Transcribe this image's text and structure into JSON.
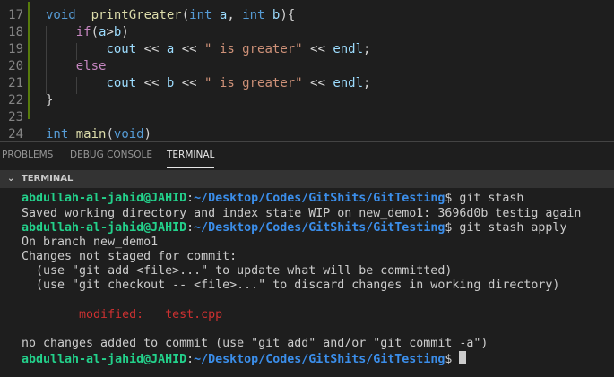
{
  "editor": {
    "line_numbers": [
      "17",
      "18",
      "19",
      "20",
      "21",
      "22",
      "23",
      "24"
    ],
    "lines": [
      [
        [
          "kw",
          "void"
        ],
        [
          "",
          "  "
        ],
        [
          "fn",
          "printGreater"
        ],
        [
          "",
          "("
        ],
        [
          "kw",
          "int"
        ],
        [
          "var",
          " a"
        ],
        [
          "",
          ", "
        ],
        [
          "kw",
          "int"
        ],
        [
          "var",
          " b"
        ],
        [
          "",
          "){"
        ]
      ],
      [
        [
          "",
          "    "
        ],
        [
          "ctl",
          "if"
        ],
        [
          "",
          "("
        ],
        [
          "var",
          "a"
        ],
        [
          "",
          ">"
        ],
        [
          "var",
          "b"
        ],
        [
          "",
          ")"
        ]
      ],
      [
        [
          "",
          "        "
        ],
        [
          "var",
          "cout"
        ],
        [
          "",
          " << "
        ],
        [
          "var",
          "a"
        ],
        [
          "",
          " << "
        ],
        [
          "str",
          "\" is greater\""
        ],
        [
          "",
          " << "
        ],
        [
          "var",
          "endl"
        ],
        [
          "",
          ";"
        ]
      ],
      [
        [
          "",
          "    "
        ],
        [
          "ctl",
          "else"
        ]
      ],
      [
        [
          "",
          "        "
        ],
        [
          "var",
          "cout"
        ],
        [
          "",
          " << "
        ],
        [
          "var",
          "b"
        ],
        [
          "",
          " << "
        ],
        [
          "str",
          "\" is greater\""
        ],
        [
          "",
          " << "
        ],
        [
          "var",
          "endl"
        ],
        [
          "",
          ";"
        ]
      ],
      [
        [
          "",
          "}"
        ]
      ],
      [
        [
          "",
          ""
        ]
      ],
      [
        [
          "kw",
          "int"
        ],
        [
          "",
          ""
        ],
        [
          "fn",
          " main"
        ],
        [
          "",
          "("
        ],
        [
          "kw",
          "void"
        ],
        [
          "",
          ")"
        ]
      ]
    ]
  },
  "panel": {
    "tabs": [
      "PROBLEMS",
      "DEBUG CONSOLE",
      "TERMINAL"
    ],
    "active_tab": "TERMINAL",
    "section_title": "TERMINAL"
  },
  "terminal": {
    "user": "abdullah-al-jahid@JAHID",
    "path": "~/Desktop/Codes/GitShits/GitTesting",
    "prompt_symbol": "$",
    "cmd1": " git stash",
    "out1": "Saved working directory and index state WIP on new_demo1: 3696d0b testig again",
    "cmd2": " git stash apply",
    "out2": "On branch new_demo1",
    "out3": "Changes not staged for commit:",
    "out4": "  (use \"git add <file>...\" to update what will be committed)",
    "out5": "  (use \"git checkout -- <file>...\" to discard changes in working directory)",
    "modified": "        modified:   test.cpp",
    "out6": "no changes added to commit (use \"git add\" and/or \"git commit -a\")"
  }
}
